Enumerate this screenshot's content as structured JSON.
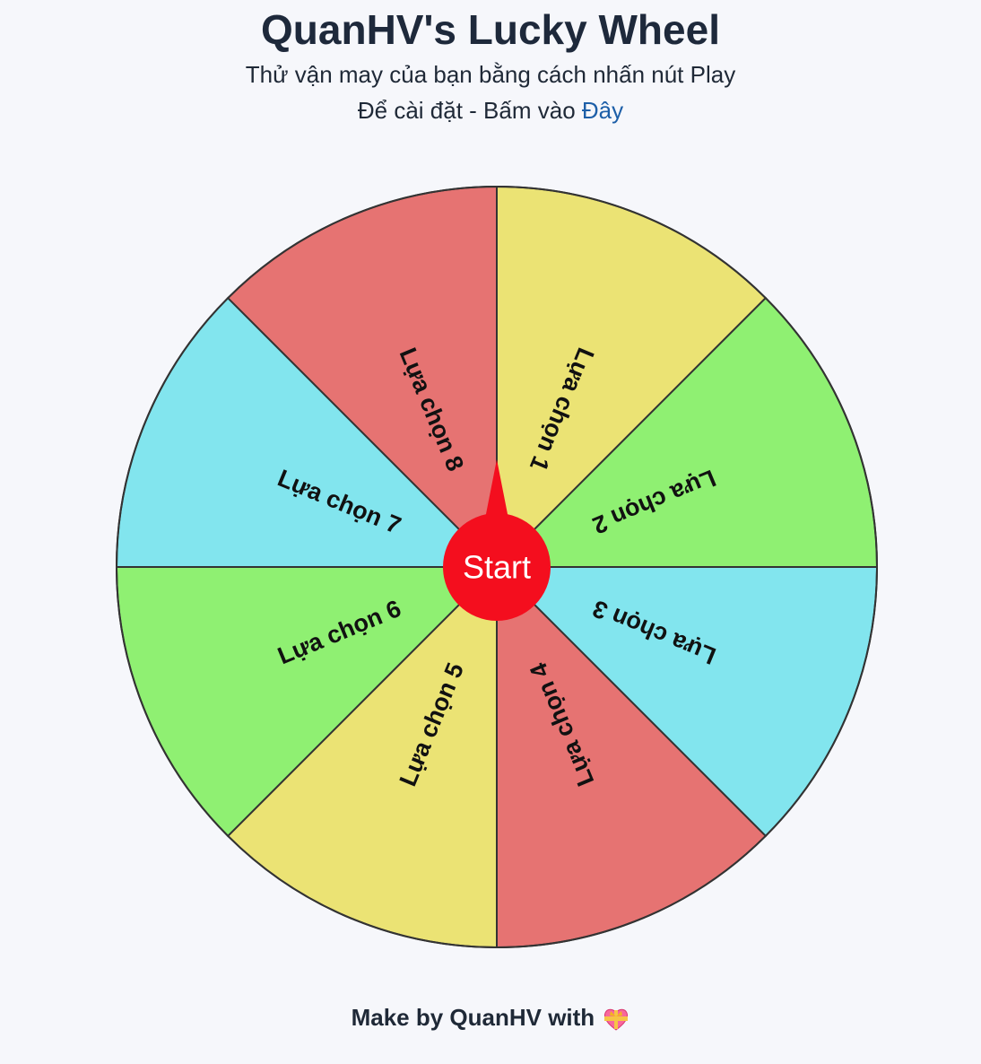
{
  "header": {
    "title": "QuanHV's Lucky Wheel",
    "subtitle": "Thử vận may của bạn bằng cách nhấn nút Play",
    "settings_prefix": "Để cài đặt - Bấm vào ",
    "settings_link": "Đây"
  },
  "wheel": {
    "colors": {
      "yellow": "#ebe374",
      "green": "#8ff072",
      "cyan": "#82e5ee",
      "red": "#e67372",
      "border": "#333333",
      "start": "#f40e1e"
    },
    "slices": [
      {
        "label": "Lựa chọn 1",
        "color": "#ebe374"
      },
      {
        "label": "Lựa chọn 2",
        "color": "#8ff072"
      },
      {
        "label": "Lựa chọn 3",
        "color": "#82e5ee"
      },
      {
        "label": "Lựa chọn 4",
        "color": "#e67372"
      },
      {
        "label": "Lựa chọn 5",
        "color": "#ebe374"
      },
      {
        "label": "Lựa chọn 6",
        "color": "#8ff072"
      },
      {
        "label": "Lựa chọn 7",
        "color": "#82e5ee"
      },
      {
        "label": "Lựa chọn 8",
        "color": "#e67372"
      }
    ],
    "start_label": "Start"
  },
  "footer": {
    "text": "Make by QuanHV with",
    "icon": "heart-with-ribbon-icon"
  }
}
